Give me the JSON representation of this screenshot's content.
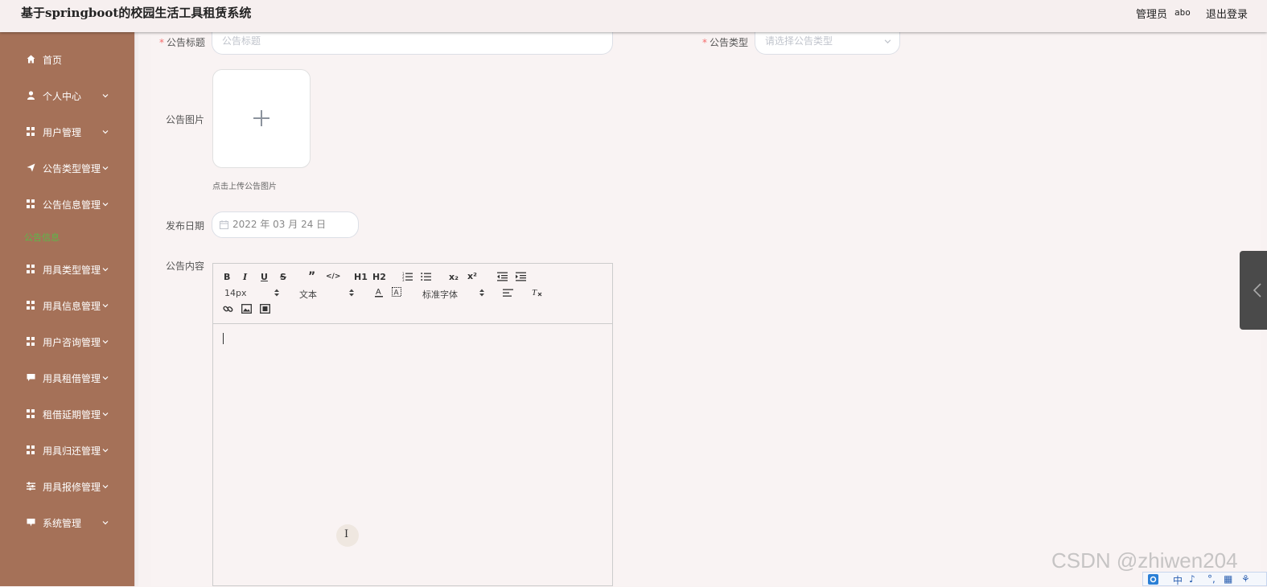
{
  "header": {
    "title": "基于springboot的校园生活工具租赁系统",
    "admin_label": "管理员",
    "admin_name": "abo",
    "logout": "退出登录"
  },
  "sidebar": {
    "items": [
      {
        "label": "首页",
        "icon": "home-icon"
      },
      {
        "label": "个人中心",
        "icon": "user-icon"
      },
      {
        "label": "用户管理",
        "icon": "grid-icon"
      },
      {
        "label": "公告类型管理",
        "icon": "send-icon"
      },
      {
        "label": "公告信息管理",
        "icon": "grid-icon"
      },
      {
        "label": "用具类型管理",
        "icon": "grid-icon"
      },
      {
        "label": "用具信息管理",
        "icon": "grid-icon"
      },
      {
        "label": "用户咨询管理",
        "icon": "grid-icon"
      },
      {
        "label": "用具租借管理",
        "icon": "chat-icon"
      },
      {
        "label": "租借延期管理",
        "icon": "grid-icon"
      },
      {
        "label": "用具归还管理",
        "icon": "grid-icon"
      },
      {
        "label": "用具报修管理",
        "icon": "sliders-icon"
      },
      {
        "label": "系统管理",
        "icon": "chat-icon"
      }
    ],
    "active_label": "公告信息"
  },
  "form": {
    "title_label": "公告标题",
    "title_placeholder": "公告标题",
    "type_label": "公告类型",
    "type_placeholder": "请选择公告类型",
    "image_label": "公告图片",
    "upload_hint": "点击上传公告图片",
    "date_label": "发布日期",
    "date_value": "2022 年 03 月 24 日",
    "content_label": "公告内容"
  },
  "editor": {
    "font_size": "14px",
    "text_style": "文本",
    "font_family": "标准字体",
    "buttons": [
      "B",
      "I",
      "U",
      "S",
      "”",
      "</>",
      "H1",
      "H2",
      "x₂",
      "x²"
    ]
  },
  "watermark": "CSDN @zhiwen204",
  "ime": [
    "中",
    "♪",
    "°,",
    "▦",
    "⚘"
  ],
  "colors": {
    "sidebar": "#a57158",
    "active": "#5cb84a",
    "required": "#f56c6c"
  }
}
